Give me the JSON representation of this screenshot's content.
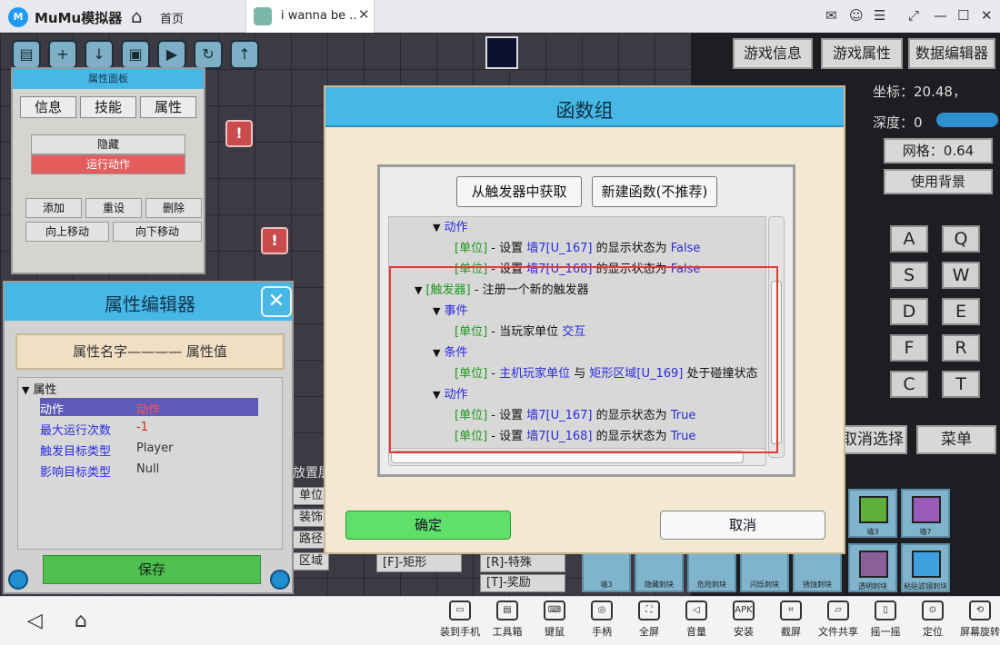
{
  "emulator": {
    "app_name": "MuMu模拟器",
    "home_tab_label": "首页",
    "game_tab_label": "i wanna be ..",
    "window_controls": [
      "mail-icon",
      "user-icon",
      "menu-icon",
      "fullscreen-icon",
      "minimize-icon",
      "maximize-icon",
      "close-icon"
    ]
  },
  "props_panel": {
    "title": "属性面板",
    "tabs": [
      "信息",
      "技能",
      "属性"
    ],
    "hide_label": "隐藏",
    "run_action_label": "运行动作",
    "add_label": "添加",
    "reset_label": "重设",
    "delete_label": "删除",
    "move_up_label": "向上移动",
    "move_down_label": "向下移动"
  },
  "attr_editor": {
    "title": "属性编辑器",
    "header_label": "属性名字———— 属性值",
    "root_label": "属性",
    "rows": [
      {
        "key": "动作",
        "value": "动作"
      },
      {
        "key": "最大运行次数",
        "value": "-1"
      },
      {
        "key": "触发目标类型",
        "value": "Player"
      },
      {
        "key": "影响目标类型",
        "value": "Null"
      }
    ],
    "save_label": "保存"
  },
  "right_panel": {
    "game_info_label": "游戏信息",
    "game_props_label": "游戏属性",
    "data_editor_label": "数据编辑器",
    "coord_text": "坐标：20.48，",
    "depth_text": "深度：0",
    "grid_label": "网格：0.64",
    "use_bg_label": "使用背景",
    "keys": [
      "A",
      "Q",
      "S",
      "W",
      "D",
      "E",
      "F",
      "R",
      "C",
      "T"
    ],
    "cancel_select_label": "取消选择",
    "menu_label": "菜单",
    "tiles": [
      "墙3",
      "墙7",
      "墙3",
      "隐藏刺块",
      "危险刺块",
      "闪烁刺块",
      "锈蚀刺块",
      "透明刺块",
      "粘贴滤镜刺块"
    ]
  },
  "bottom_strip": {
    "layer_label": "放置层",
    "buttons": [
      "单位",
      "装饰",
      "路径",
      "区域"
    ],
    "rect_label": "[F]-矩形",
    "special_label": "[R]-特殊",
    "reward_label": "[T]-奖励"
  },
  "modal": {
    "title": "函数组",
    "get_from_trigger_label": "从触发器中获取",
    "new_function_label": "新建函数(不推荐)",
    "tree": [
      {
        "indent": 1,
        "arrow": "▼",
        "tag": "",
        "text": "",
        "blue": "动作"
      },
      {
        "indent": 2,
        "arrow": "",
        "tag": "[单位]",
        "text": " - 设置 ",
        "blue": "墙7[U_167]",
        "tail": " 的显示状态为 ",
        "val": "False"
      },
      {
        "indent": 2,
        "arrow": "",
        "tag": "[单位]",
        "text": " - 设置 ",
        "blue": "墙7[U_168]",
        "tail": " 的显示状态为 ",
        "val": "False"
      },
      {
        "indent": 0,
        "arrow": "▼",
        "tag": "[触发器]",
        "text": " - 注册一个新的触发器",
        "blue": ""
      },
      {
        "indent": 1,
        "arrow": "▼",
        "tag": "",
        "text": "",
        "blue": "事件"
      },
      {
        "indent": 2,
        "arrow": "",
        "tag": "[单位]",
        "text": " - 当玩家单位 ",
        "blue": "交互"
      },
      {
        "indent": 1,
        "arrow": "▼",
        "tag": "",
        "text": "",
        "blue": "条件"
      },
      {
        "indent": 2,
        "arrow": "",
        "tag": "[单位]",
        "text": " - ",
        "blue": "主机玩家单位",
        "tail": " 与 ",
        "val": "矩形区域[U_169]",
        "tail2": " 处于碰撞状态"
      },
      {
        "indent": 1,
        "arrow": "▼",
        "tag": "",
        "text": "",
        "blue": "动作"
      },
      {
        "indent": 2,
        "arrow": "",
        "tag": "[单位]",
        "text": " - 设置 ",
        "blue": "墙7[U_167]",
        "tail": " 的显示状态为 ",
        "val": "True"
      },
      {
        "indent": 2,
        "arrow": "",
        "tag": "[单位]",
        "text": " - 设置 ",
        "blue": "墙7[U_168]",
        "tail": " 的显示状态为 ",
        "val": "True"
      }
    ],
    "ok_label": "确定",
    "cancel_label": "取消"
  },
  "navbar": {
    "items": [
      "装到手机",
      "工具箱",
      "键鼠",
      "手柄",
      "全屏",
      "音量",
      "安装",
      "截屏",
      "文件共享",
      "摇一摇",
      "定位",
      "屏幕旋转"
    ]
  },
  "colors": {
    "accent_blue": "#47b7e6",
    "confirm_green": "#5ee06a",
    "highlight_red": "#e53935",
    "keyword_blue": "#2a2ae0",
    "tag_green": "#1a9a1a"
  }
}
